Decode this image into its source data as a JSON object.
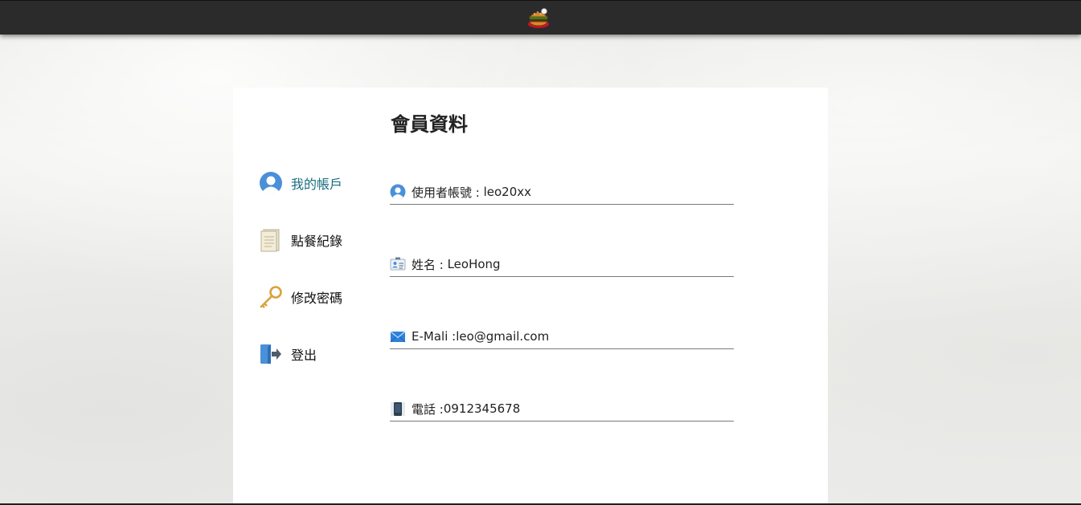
{
  "colors": {
    "topbar": "#2b2b2b",
    "active_nav": "#1a6f80",
    "text": "#222222",
    "card": "#ffffff"
  },
  "header": {
    "logo_icon": "burger-logo-icon"
  },
  "page": {
    "title": "會員資料"
  },
  "sidebar": {
    "items": [
      {
        "label": "我的帳戶",
        "icon": "user-avatar-icon",
        "active": true
      },
      {
        "label": "點餐紀錄",
        "icon": "document-icon",
        "active": false
      },
      {
        "label": "修改密碼",
        "icon": "key-icon",
        "active": false
      },
      {
        "label": "登出",
        "icon": "logout-icon",
        "active": false
      }
    ]
  },
  "profile": {
    "fields": [
      {
        "label": "使用者帳號 : ",
        "value": "leo20xx",
        "icon": "user-avatar-icon"
      },
      {
        "label": "姓名 : ",
        "value": "LeoHong",
        "icon": "id-card-icon"
      },
      {
        "label": "E-Mali :",
        "value": "leo@gmail.com",
        "icon": "mail-icon"
      },
      {
        "label": "電話 :",
        "value": "0912345678",
        "icon": "phone-icon"
      }
    ]
  }
}
